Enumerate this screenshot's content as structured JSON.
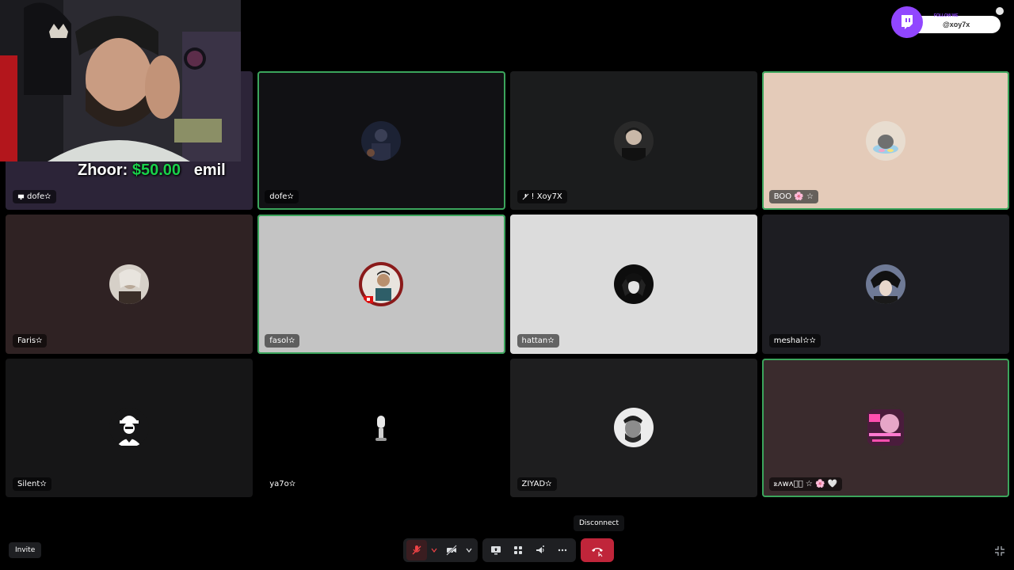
{
  "tiles": [
    {
      "name": "dofe✫",
      "bg": "#2c2438",
      "speaking": false
    },
    {
      "name": "dofe✫",
      "bg": "#111114",
      "speaking": true
    },
    {
      "name": "! Xoy7X",
      "bg": "#1b1c1d",
      "speaking": false
    },
    {
      "name": "BOO 🌸 ☆",
      "bg": "#e4cbb9",
      "speaking": true
    },
    {
      "name": "Faris✫",
      "bg": "#2f2223",
      "speaking": false
    },
    {
      "name": "fasol✫",
      "bg": "#c4c4c4",
      "speaking": true
    },
    {
      "name": "hattan✫",
      "bg": "#dcdcdc",
      "speaking": false
    },
    {
      "name": "meshal✫✫",
      "bg": "#1d1d22",
      "speaking": false
    },
    {
      "name": "Silent✫",
      "bg": "#161617",
      "speaking": false
    },
    {
      "name": "ya7o✫",
      "bg": "#000000",
      "speaking": false
    },
    {
      "name": "ZIYAD✫",
      "bg": "#1e1e1f",
      "speaking": false
    },
    {
      "name": "ꭱᴧᴡᴧᏴ᳐ ☆ 🌸 🤍",
      "bg": "#3a2b2d",
      "speaking": true
    }
  ],
  "overlay": {
    "donor": "Zhoor:",
    "amount": "$50.00",
    "message": "emil"
  },
  "follow": {
    "label": "FOLLOW ME",
    "handle": "@xoy7x",
    "brand_color": "#9146ff"
  },
  "controls": {
    "invite_label": "Invite",
    "tooltip": "Disconnect",
    "disconnect_color": "#c0253a"
  },
  "icons": {
    "mic": "mic-muted-icon",
    "camera": "camera-off-icon",
    "screen": "screen-share-icon",
    "activities": "activities-icon",
    "soundboard": "soundboard-icon",
    "more": "more-icon",
    "disconnect": "phone-hangup-icon",
    "fullscreen": "fullscreen-icon"
  }
}
